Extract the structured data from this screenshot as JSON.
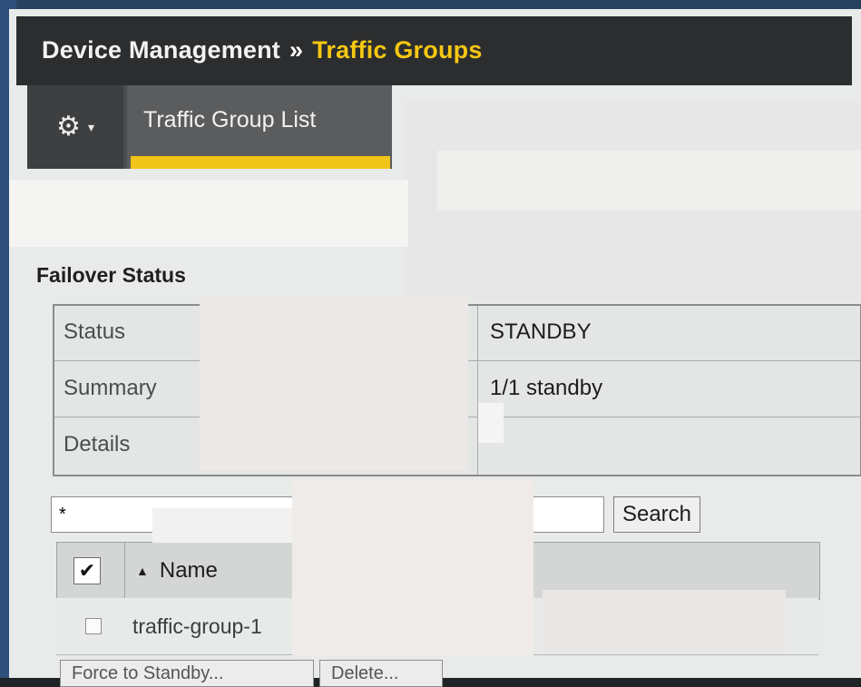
{
  "header": {
    "section": "Device Management",
    "separator": "»",
    "current": "Traffic Groups"
  },
  "toolbar": {
    "menu_icon": "gear-icon",
    "menu_caret": "▾",
    "active_tab": "Traffic Group List"
  },
  "failover": {
    "title": "Failover Status",
    "rows": [
      {
        "label": "Status",
        "value": "STANDBY"
      },
      {
        "label": "Summary",
        "value": "1/1 standby"
      },
      {
        "label": "Details",
        "value": ""
      }
    ]
  },
  "search": {
    "value": "*",
    "button_label": "Search"
  },
  "list": {
    "header_checkbox": "✔",
    "sort_indicator": "▲",
    "column_name": "Name",
    "rows": [
      {
        "name": "traffic-group-1"
      }
    ]
  },
  "actions": {
    "force_standby": "Force to Standby...",
    "delete": "Delete..."
  },
  "colors": {
    "accent": "#f0c419",
    "header_bg": "#2b2d2f"
  }
}
